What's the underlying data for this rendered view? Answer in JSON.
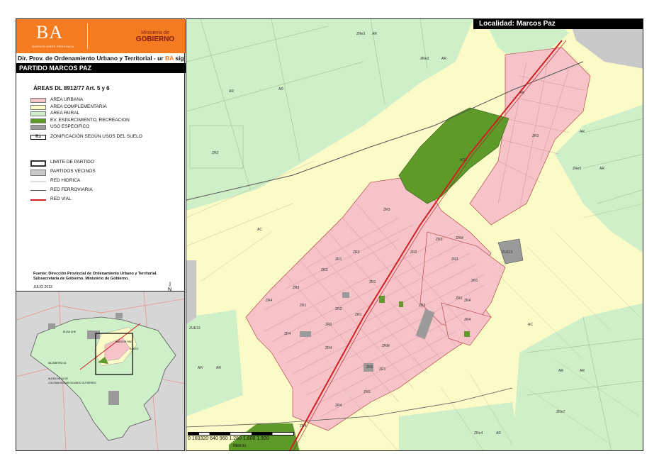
{
  "header": {
    "brand_name": "BA",
    "brand_sub": "BUENOS AIRES PROVINCIA",
    "ministry_line1": "Ministerio de",
    "ministry_line2": "GOBIERNO",
    "directorate": "Dir. Prov. de Ordenamiento Urbano y Territorial - ur",
    "directorate_accent": "BA",
    "directorate_tail": "sig",
    "partido": "PARTIDO MARCOS PAZ"
  },
  "legend": {
    "title": "ÁREAS DL 8912/77 Art. 5 y 6",
    "areas": [
      {
        "label": "AREA URBANA",
        "color": "#f6c3c8"
      },
      {
        "label": "AREA COMPLEMENTARIA",
        "color": "#fbfbc8"
      },
      {
        "label": "AREA RURAL",
        "color": "#cfefc9"
      },
      {
        "label": "EV. ESPARCIMIENTO, RECREACION",
        "color": "#5e9a2a"
      },
      {
        "label": "USO ESPECIFICO",
        "color": "#9a9a9a"
      }
    ],
    "zoning_code": "R1",
    "zoning_label": "ZONIFICACIÓN SEGÚN USOS DEL SUELO",
    "boundaries": [
      {
        "label": "LIMITE DE PARTIDO",
        "kind": "box",
        "color": "#ffffff"
      },
      {
        "label": "PARTIDOS VECINOS",
        "kind": "box",
        "color": "#c8c8c8"
      },
      {
        "label": "RED HIDRICA",
        "kind": "line",
        "color": "#dddddd"
      },
      {
        "label": "RED FERROVIARIA",
        "kind": "line",
        "color": "#555555"
      },
      {
        "label": "RED VIAL",
        "kind": "line",
        "color": "#d21f1f"
      }
    ]
  },
  "source": {
    "line1": "Fuente: Dirección Provincial de Ordenamiento Urbano y Territorial.",
    "line2": "Subsecretaria de Gobierno. Ministerio de Gobierno.",
    "date": "JULIO 2013",
    "north": "N"
  },
  "overview": {
    "labels": [
      "ELISA CHE",
      "MARCOS PAZ",
      "SANTO",
      "KILOMETRO 42",
      "ALDEA DE LA DE",
      "COLONIA HOGAR RICARDO GUTIERREZ"
    ]
  },
  "main_map": {
    "locality": "Localidad: Marcos Paz",
    "colors": {
      "urban": "#f6c3c8",
      "complementary": "#fbfbc8",
      "rural": "#cfefc9",
      "recreation": "#5e9a2a",
      "specific_use": "#9a9a9a",
      "neighbor": "#c8c8c8",
      "road": "#d21f1f",
      "rail": "#555555"
    },
    "zone_labels": [
      "ZRe3",
      "AR",
      "ZRe3",
      "AR",
      "ZR3",
      "AR",
      "AR",
      "ZRe5",
      "AR",
      "AO1",
      "AR",
      "ZR2",
      "ZR1",
      "ZR3",
      "ZR2",
      "ZR3",
      "ZR3",
      "ZR4",
      "ZR1",
      "ZR2",
      "ZR3",
      "ZR4",
      "ZR1",
      "ZUE15",
      "ZR3",
      "ZR2",
      "ZR4",
      "ZR1",
      "ZR2",
      "ZR3",
      "ZRM",
      "ZR4",
      "ZRM",
      "ZR1",
      "ZR3",
      "ZR2",
      "ZR4",
      "ZR5",
      "ZR4",
      "ZUE13",
      "AC",
      "AC",
      "AR",
      "AR",
      "AR",
      "AR",
      "AR",
      "ZRe7",
      "ZRe4",
      "AR",
      "ZR1",
      "ZR4"
    ],
    "scale_labels": "0 160320    640    960    1.280  1.600  1.920",
    "scale_unit": "Metros"
  }
}
